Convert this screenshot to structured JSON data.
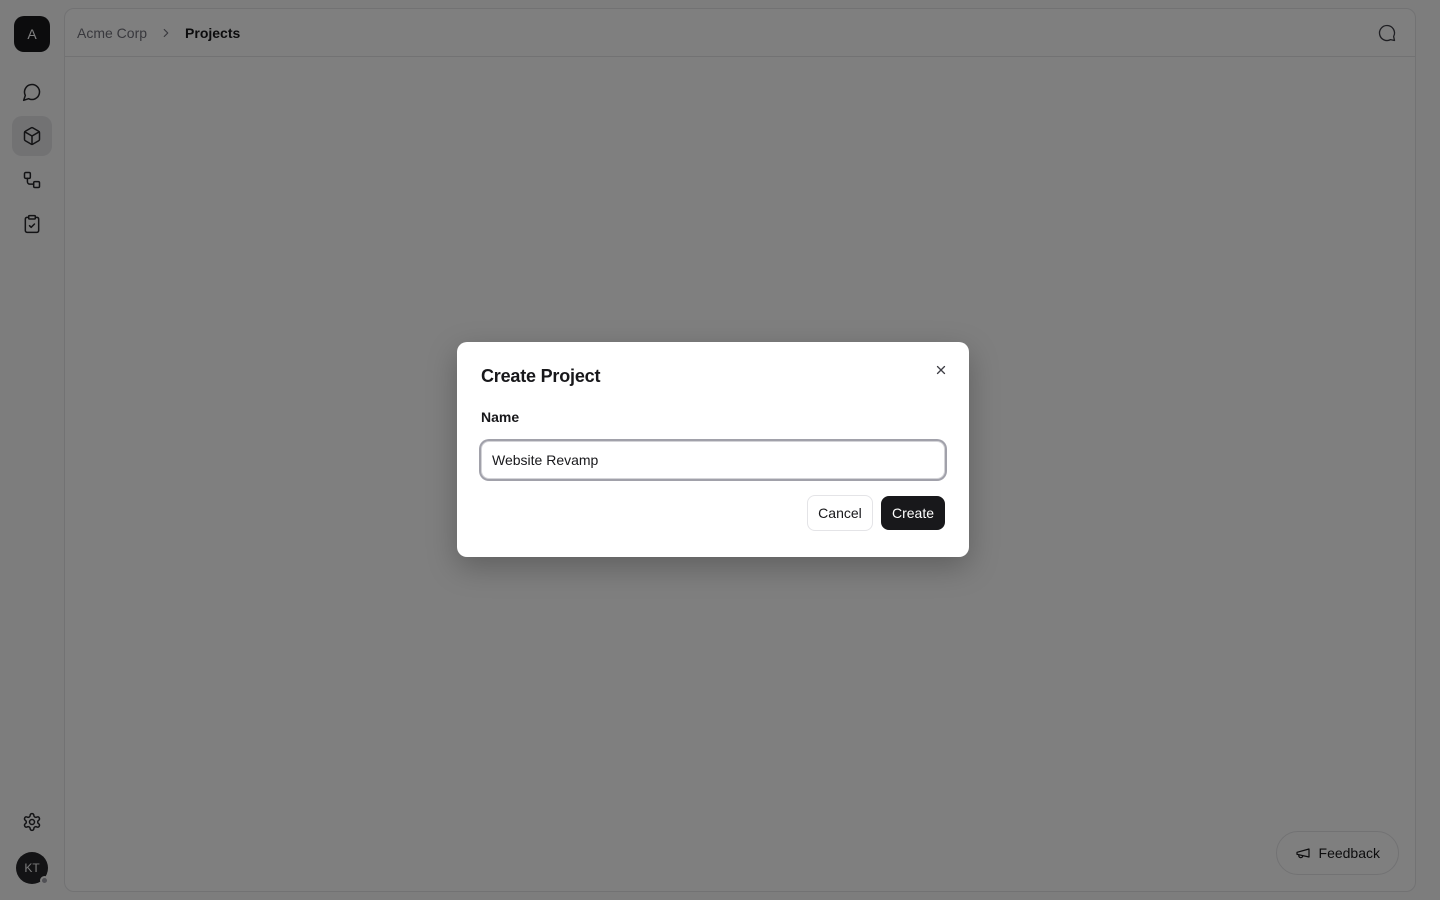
{
  "app": {
    "logo_letter": "A",
    "user_initials": "KT"
  },
  "sidebar": {
    "items": [
      {
        "name": "chat",
        "icon": "message-circle-icon",
        "active": false
      },
      {
        "name": "projects",
        "icon": "box-icon",
        "active": true
      },
      {
        "name": "workflows",
        "icon": "workflow-icon",
        "active": false
      },
      {
        "name": "tasks",
        "icon": "clipboard-check-icon",
        "active": false
      }
    ],
    "bottom": [
      {
        "name": "settings",
        "icon": "gear-icon"
      }
    ]
  },
  "header": {
    "breadcrumb": [
      "Acme Corp",
      "Projects"
    ],
    "right_icon": "chat-bubble-icon"
  },
  "feedback": {
    "label": "Feedback",
    "icon": "megaphone-icon"
  },
  "modal": {
    "title": "Create Project",
    "name_label": "Name",
    "name_value": "Website Revamp",
    "cancel_label": "Cancel",
    "create_label": "Create"
  },
  "colors": {
    "primary": "#18181b",
    "border": "#e4e4e7",
    "background": "#fafafa",
    "overlay": "rgba(0,0,0,0.5)"
  }
}
